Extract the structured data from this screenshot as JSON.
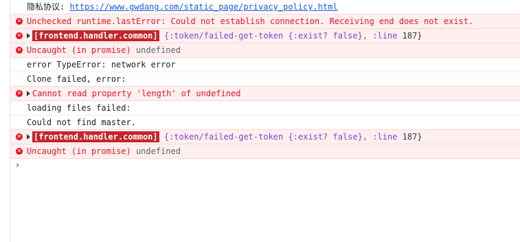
{
  "console": {
    "privacy_label": "隐私协议: ",
    "privacy_url": "https://www.gwdang.com/static_page/privacy_policy.html",
    "msg_runtime_error": "Unchecked runtime.lastError: Could not establish connection. Receiving end does not exist.",
    "handler_badge_1": "[frontend.handler.common]",
    "handler_token_1": "{:token/failed-get-token {:exist? false}",
    "handler_line_label_1": ":line",
    "handler_line_num_1": "187}",
    "uncaught_1": "Uncaught (in promise)",
    "uncaught_value_1": "undefined",
    "type_error": "error TypeError: network error",
    "clone_failed": "Clone failed, error:",
    "length_error": "Cannot read property 'length' of undefined",
    "loading_failed": "loading files failed:",
    "master_missing": "Could not find master.",
    "handler_badge_2": "[frontend.handler.common]",
    "handler_token_2": "{:token/failed-get-token {:exist? false}",
    "handler_line_label_2": ":line",
    "handler_line_num_2": "187}",
    "uncaught_2": "Uncaught (in promise)",
    "uncaught_value_2": "undefined",
    "prompt_symbol": "›"
  },
  "colors": {
    "error_text": "#e8131d",
    "error_bg": "#fff0f0",
    "badge_bg": "#c3262b",
    "link": "#1a5ad4"
  },
  "icons": {
    "error": "error-circle-icon",
    "expand": "expand-triangle-icon",
    "prompt": "chevron-right-icon"
  }
}
